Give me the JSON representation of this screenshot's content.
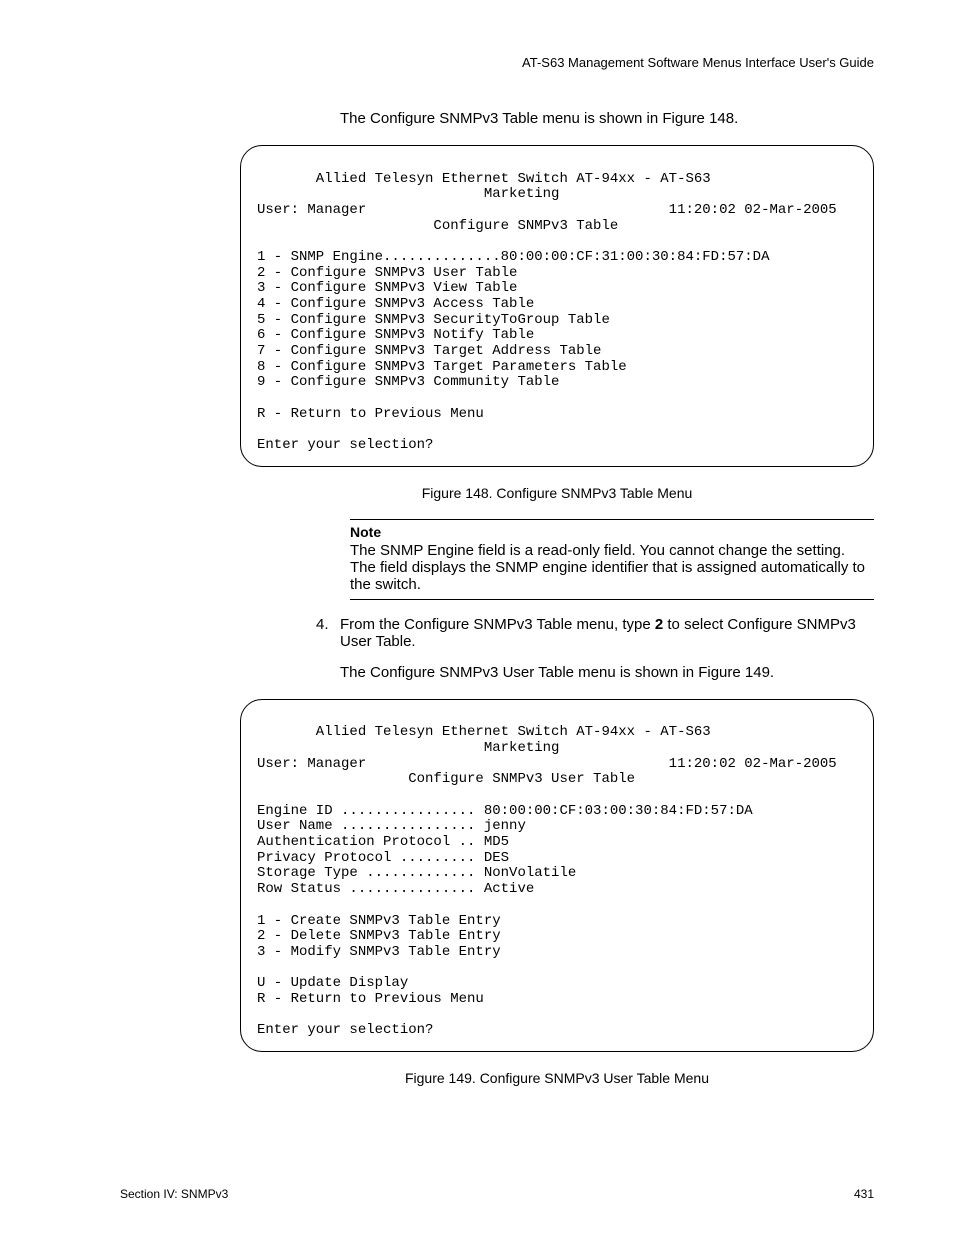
{
  "header": {
    "right": "AT-S63 Management Software Menus Interface User's Guide"
  },
  "intro1": "The Configure SNMPv3 Table menu is shown in Figure 148.",
  "terminal1": {
    "title": "       Allied Telesyn Ethernet Switch AT-94xx - AT-S63",
    "subtitle": "                           Marketing",
    "userline_left": "User: Manager",
    "userline_right": "11:20:02 02-Mar-2005",
    "menuname": "                     Configure SNMPv3 Table",
    "items": [
      "1 - SNMP Engine..............80:00:00:CF:31:00:30:84:FD:57:DA",
      "2 - Configure SNMPv3 User Table",
      "3 - Configure SNMPv3 View Table",
      "4 - Configure SNMPv3 Access Table",
      "5 - Configure SNMPv3 SecurityToGroup Table",
      "6 - Configure SNMPv3 Notify Table",
      "7 - Configure SNMPv3 Target Address Table",
      "8 - Configure SNMPv3 Target Parameters Table",
      "9 - Configure SNMPv3 Community Table"
    ],
    "return": "R - Return to Previous Menu",
    "prompt": "Enter your selection?"
  },
  "caption1": "Figure 148. Configure SNMPv3 Table Menu",
  "note": {
    "title": "Note",
    "text": "The SNMP Engine field is a read-only field. You cannot change the setting. The field displays the SNMP engine identifier that is assigned automatically to the switch."
  },
  "step4_num": "4.",
  "step4_a": "From the Configure SNMPv3 Table menu, type ",
  "step4_b_bold": "2",
  "step4_c": " to select Configure SNMPv3 User Table.",
  "intro2": "The Configure SNMPv3 User Table menu is shown in Figure 149.",
  "terminal2": {
    "title": "       Allied Telesyn Ethernet Switch AT-94xx - AT-S63",
    "subtitle": "                           Marketing",
    "userline_left": "User: Manager",
    "userline_right": "11:20:02 02-Mar-2005",
    "menuname": "                  Configure SNMPv3 User Table",
    "fields": [
      "Engine ID ................ 80:00:00:CF:03:00:30:84:FD:57:DA",
      "User Name ................ jenny",
      "Authentication Protocol .. MD5",
      "Privacy Protocol ......... DES",
      "Storage Type ............. NonVolatile",
      "Row Status ............... Active"
    ],
    "items": [
      "1 - Create SNMPv3 Table Entry",
      "2 - Delete SNMPv3 Table Entry",
      "3 - Modify SNMPv3 Table Entry"
    ],
    "update": "U - Update Display",
    "return": "R - Return to Previous Menu",
    "prompt": "Enter your selection?"
  },
  "caption2": "Figure 149. Configure SNMPv3 User Table Menu",
  "footer": {
    "left": "Section IV: SNMPv3",
    "right": "431"
  }
}
